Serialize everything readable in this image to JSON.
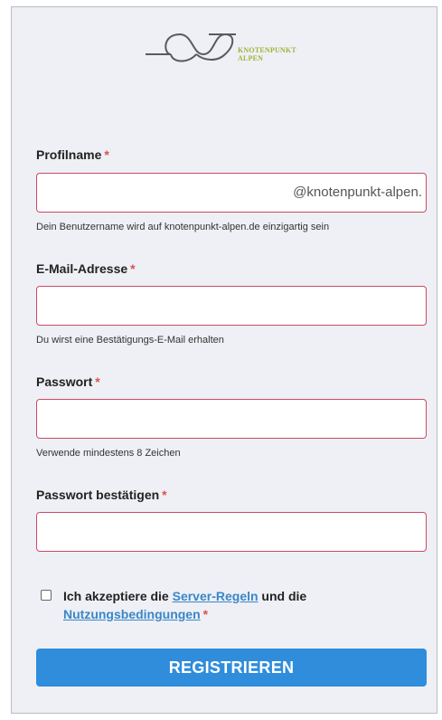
{
  "brand": {
    "line1": "KNOTENPUNKT",
    "line2": "ALPEN",
    "accent_color": "#a3b13b",
    "logo_icon": "knot-logo-icon"
  },
  "form": {
    "profile": {
      "label": "Profilname",
      "required_mark": "*",
      "value": "",
      "suffix": "@knotenpunkt-alpen.",
      "hint": "Dein Benutzername wird auf knotenpunkt-alpen.de einzigartig sein"
    },
    "email": {
      "label": "E-Mail-Adresse",
      "required_mark": "*",
      "value": "",
      "hint": "Du wirst eine Bestätigungs-E-Mail erhalten"
    },
    "password": {
      "label": "Passwort",
      "required_mark": "*",
      "value": "",
      "hint": "Verwende mindestens 8 Zeichen"
    },
    "confirm": {
      "label": "Passwort bestätigen",
      "required_mark": "*",
      "value": ""
    },
    "agreement": {
      "text_before": "Ich akzeptiere die ",
      "link_rules": "Server-Regeln",
      "text_middle": " und die ",
      "link_terms": "Nutzungsbedingungen",
      "required_mark": "*",
      "checked": false
    },
    "submit_label": "REGISTRIEREN"
  },
  "colors": {
    "field_border": "#cb4a63",
    "button": "#2f8ddb",
    "link": "#3a86c8",
    "required": "#d9534f"
  }
}
